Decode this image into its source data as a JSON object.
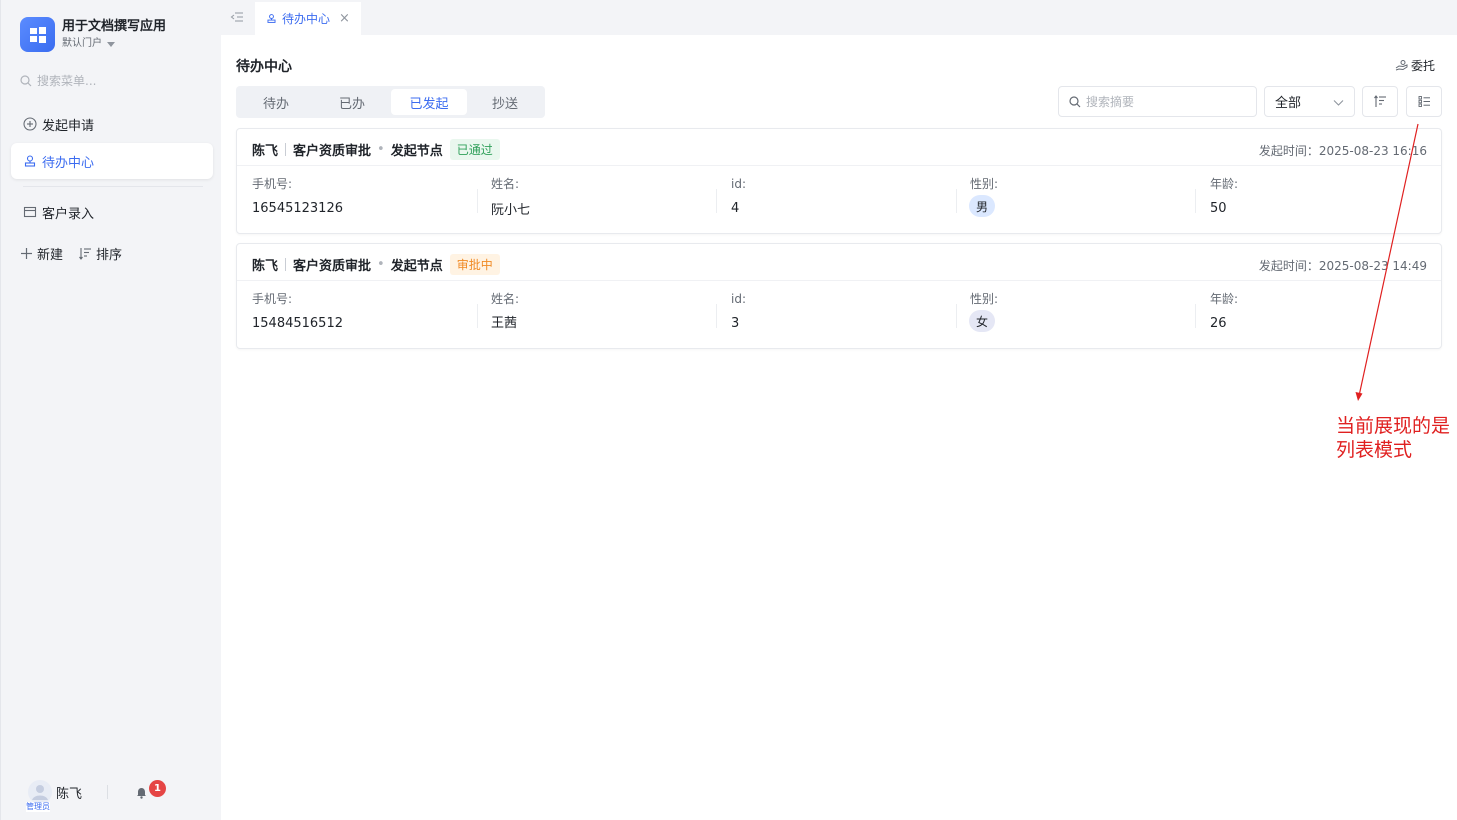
{
  "app": {
    "title": "用于文档撰写应用",
    "portal": "默认门户"
  },
  "sidebar": {
    "search_placeholder": "搜索菜单...",
    "items": [
      {
        "label": "发起申请",
        "icon": "plus-circle-icon"
      },
      {
        "label": "待办中心",
        "icon": "user-stamp-icon",
        "active": true
      },
      {
        "label": "客户录入",
        "icon": "form-icon"
      }
    ],
    "actions": {
      "new_label": "新建",
      "sort_label": "排序"
    },
    "footer": {
      "user_name": "陈飞",
      "role_tag": "管理员",
      "notification_count": "1"
    }
  },
  "tabbar": {
    "tabs": [
      {
        "label": "待办中心",
        "close": "×"
      }
    ]
  },
  "main": {
    "title": "待办中心",
    "delegate_label": "委托",
    "segments": [
      "待办",
      "已办",
      "已发起",
      "抄送"
    ],
    "active_segment": "已发起",
    "search_placeholder": "搜索摘要",
    "filter_value": "全部"
  },
  "cards": [
    {
      "initiator": "陈飞",
      "process": "客户资质审批",
      "node": "发起节点",
      "status": "已通过",
      "time": "发起时间：2025-08-23 16:16",
      "fields": [
        {
          "label": "手机号:",
          "value": "16545123126"
        },
        {
          "label": "姓名:",
          "value": "阮小七"
        },
        {
          "label": "id:",
          "value": "4"
        },
        {
          "label": "性别:",
          "value": "男"
        },
        {
          "label": "年龄:",
          "value": "50"
        }
      ]
    },
    {
      "initiator": "陈飞",
      "process": "客户资质审批",
      "node": "发起节点",
      "status": "审批中",
      "time": "发起时间：2025-08-23 14:49",
      "fields": [
        {
          "label": "手机号:",
          "value": "15484516512"
        },
        {
          "label": "姓名:",
          "value": "王茜"
        },
        {
          "label": "id:",
          "value": "3"
        },
        {
          "label": "性别:",
          "value": "女"
        },
        {
          "label": "年龄:",
          "value": "26"
        }
      ]
    }
  ],
  "annotation": {
    "line1": "当前展现的是",
    "line2": "列表模式",
    "color": "#e02020"
  },
  "colors": {
    "accent": "#3c6cf0",
    "status_pass": "#2fa05a",
    "status_pending": "#f08a24",
    "badge": "#e54545"
  }
}
